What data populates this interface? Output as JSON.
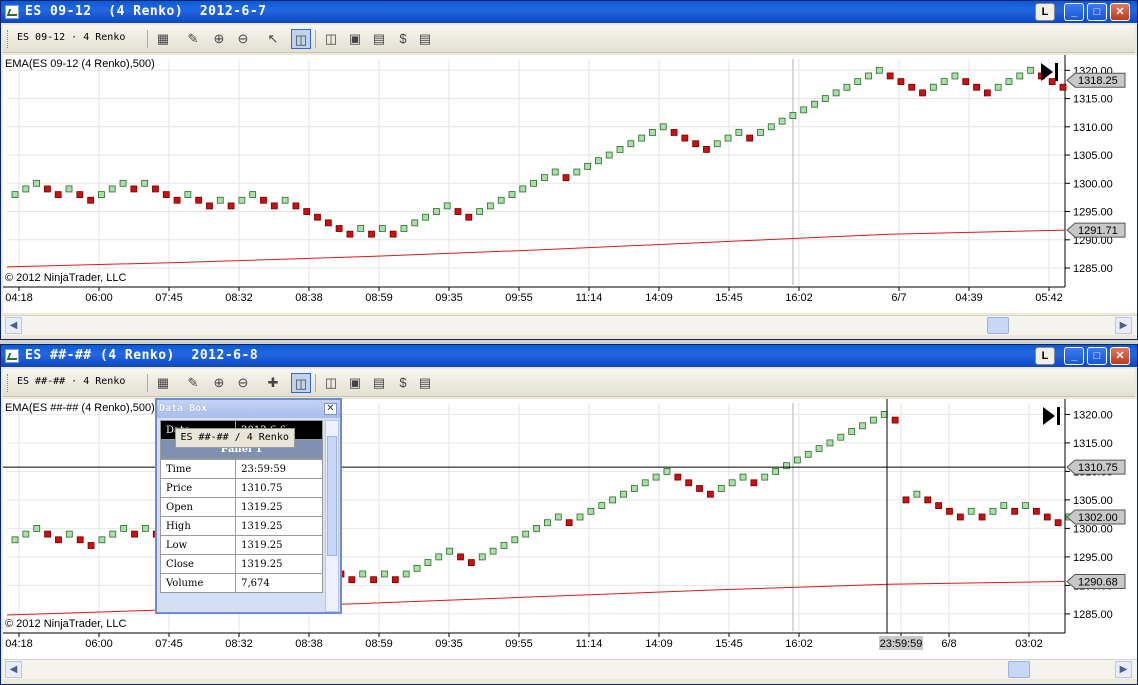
{
  "windows": [
    {
      "title": "ES 09-12  (4 Renko)  2012-6-7",
      "instrument_selector": "ES 09-12 · 4 Renko",
      "buttons": {
        "layout": "L",
        "minimize": "_",
        "maximize": "□",
        "close": "✕"
      }
    },
    {
      "title": "ES ##-## (4 Renko)  2012-6-8",
      "instrument_selector": "ES ##-## · 4 Renko",
      "buttons": {
        "layout": "L",
        "minimize": "_",
        "maximize": "□",
        "close": "✕"
      }
    }
  ],
  "toolbar_icons": [
    "chart-style-icon",
    "pencil-icon",
    "zoom-in-icon",
    "zoom-out-icon",
    "pointer-icon",
    "crosshair-icon",
    "data-box-icon",
    "strategy-icon",
    "indicator-icon",
    "chart-icon",
    "dollar-icon",
    "properties-icon"
  ],
  "colors": {
    "up_brick": "#a8e0a8",
    "down_brick": "#cc1010",
    "ema_line": "#e01818",
    "grid": "#e6e6e6"
  },
  "charts": [
    {
      "indicator_label": "EMA(ES 09-12 (4 Renko),500)",
      "copyright": "© 2012 NinjaTrader, LLC",
      "y_ticks": [
        "1320.00",
        "1315.00",
        "1310.00",
        "1305.00",
        "1300.00",
        "1295.00",
        "1290.00",
        "1285.00"
      ],
      "x_ticks": [
        "04:18",
        "06:00",
        "07:45",
        "08:32",
        "08:38",
        "08:59",
        "09:35",
        "09:55",
        "11:14",
        "14:09",
        "15:45",
        "16:02",
        "6/7",
        "04:39",
        "05:42"
      ],
      "price_marker": "1318.25",
      "ema_marker": "1291.71"
    },
    {
      "indicator_label": "EMA(ES ##-## (4 Renko),500)",
      "copyright": "© 2012 NinjaTrader, LLC",
      "y_ticks": [
        "1320.00",
        "1315.00",
        "1310.00",
        "1305.00",
        "1300.00",
        "1295.00",
        "1290.00",
        "1285.00"
      ],
      "x_ticks": [
        "04:18",
        "06:00",
        "07:45",
        "08:32",
        "08:38",
        "08:59",
        "09:35",
        "09:55",
        "11:14",
        "14:09",
        "15:45",
        "16:02",
        "23:59:59",
        "6/8",
        "03:02"
      ],
      "crosshair_marker": "1310.75",
      "price_marker": "1302.00",
      "ema_marker": "1290.68"
    }
  ],
  "data_box": {
    "title": "Data Box",
    "close": "✕",
    "date_label": "Date",
    "date_value": "2012-6-6",
    "panel_label": "Panel 1",
    "instrument": "ES ##-## / 4 Renko",
    "rows": [
      {
        "label": "Time",
        "value": "23:59:59"
      },
      {
        "label": "Price",
        "value": "1310.75"
      },
      {
        "label": "Open",
        "value": "1319.25"
      },
      {
        "label": "High",
        "value": "1319.25"
      },
      {
        "label": "Low",
        "value": "1319.25"
      },
      {
        "label": "Close",
        "value": "1319.25"
      },
      {
        "label": "Volume",
        "value": "7,674"
      }
    ]
  },
  "chart_data": [
    {
      "type": "scatter",
      "title": "",
      "xlabel": "",
      "ylabel": "",
      "ylim": [
        1282,
        1322
      ],
      "categories": [
        "04:18",
        "06:00",
        "07:45",
        "08:32",
        "08:38",
        "08:59",
        "09:35",
        "09:55",
        "11:14",
        "14:09",
        "15:45",
        "16:02",
        "6/7",
        "04:39",
        "05:42"
      ],
      "series": [
        {
          "values": [
            1298,
            1299,
            1300,
            1299,
            1298,
            1299,
            1298,
            1297,
            1298,
            1299,
            1300,
            1299,
            1300,
            1299,
            1298,
            1297,
            1298,
            1297,
            1296,
            1297,
            1296,
            1297,
            1298,
            1297,
            1296,
            1297,
            1296,
            1295,
            1294,
            1293,
            1292,
            1291,
            1292,
            1291,
            1292,
            1291,
            1292,
            1293,
            1294,
            1295,
            1296,
            1295,
            1294,
            1295,
            1296,
            1297,
            1298,
            1299,
            1300,
            1301,
            1302,
            1301,
            1302,
            1303,
            1304,
            1305,
            1306,
            1307,
            1308,
            1309,
            1310,
            1309,
            1308,
            1307,
            1306,
            1307,
            1308,
            1309,
            1308,
            1309,
            1310,
            1311,
            1312,
            1313,
            1314,
            1315,
            1316,
            1317,
            1318,
            1319,
            1320,
            1319,
            1318,
            1317,
            1316,
            1317,
            1318,
            1319,
            1318,
            1317,
            1316,
            1317,
            1318,
            1319,
            1320,
            1319,
            1318,
            1317
          ]
        },
        {
          "values": [
            1285.2,
            1286.0,
            1287.0,
            1288.2,
            1289.6,
            1291.0,
            1291.71
          ]
        }
      ]
    },
    {
      "type": "scatter",
      "title": "",
      "xlabel": "",
      "ylabel": "",
      "ylim": [
        1282,
        1322
      ],
      "categories": [
        "04:18",
        "06:00",
        "07:45",
        "08:32",
        "08:38",
        "08:59",
        "09:35",
        "09:55",
        "11:14",
        "14:09",
        "15:45",
        "16:02",
        "23:59:59",
        "6/8",
        "03:02"
      ],
      "series": [
        {
          "values": [
            1298,
            1299,
            1300,
            1299,
            1298,
            1299,
            1298,
            1297,
            1298,
            1299,
            1300,
            1299,
            1300,
            1299,
            1298,
            1297,
            1298,
            1297,
            1296,
            1297,
            1296,
            1297,
            1298,
            1297,
            1296,
            1297,
            1296,
            1295,
            1294,
            1293,
            1292,
            1291,
            1292,
            1291,
            1292,
            1291,
            1292,
            1293,
            1294,
            1295,
            1296,
            1295,
            1294,
            1295,
            1296,
            1297,
            1298,
            1299,
            1300,
            1301,
            1302,
            1301,
            1302,
            1303,
            1304,
            1305,
            1306,
            1307,
            1308,
            1309,
            1310,
            1309,
            1308,
            1307,
            1306,
            1307,
            1308,
            1309,
            1308,
            1309,
            1310,
            1311,
            1312,
            1313,
            1314,
            1315,
            1316,
            1317,
            1318,
            1319,
            1320,
            1319,
            1305,
            1306,
            1305,
            1304,
            1303,
            1302,
            1303,
            1302,
            1303,
            1304,
            1303,
            1304,
            1303,
            1302,
            1301,
            1302
          ]
        },
        {
          "values": [
            1284.8,
            1285.8,
            1286.8,
            1288.0,
            1289.2,
            1290.2,
            1290.68
          ]
        }
      ]
    }
  ]
}
